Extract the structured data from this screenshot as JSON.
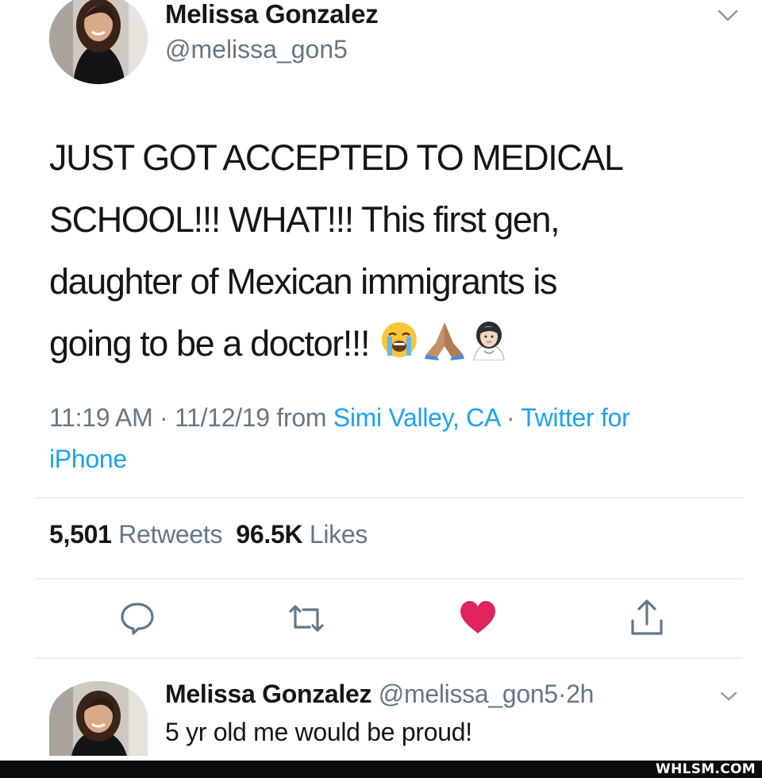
{
  "tweet": {
    "author_name": "Melissa Gonzalez",
    "author_handle": "@melissa_gon5",
    "text_lines": [
      "JUST GOT ACCEPTED TO MEDICAL",
      "SCHOOL!!! WHAT!!! This first gen,",
      "daughter of Mexican immigrants is",
      "going to be a doctor!!!"
    ],
    "emojis": [
      "loudly-crying-face",
      "folded-hands",
      "woman-health-worker"
    ],
    "time": "11:19 AM",
    "date": "11/12/19",
    "from_label": "from",
    "location": "Simi Valley, CA",
    "source_line1": "Twitter for",
    "source_line2": "iPhone",
    "separator": "·"
  },
  "stats": {
    "retweets_count": "5,501",
    "retweets_label": "Retweets",
    "likes_count": "96.5K",
    "likes_label": "Likes"
  },
  "actions": [
    {
      "name": "reply",
      "icon": "speech-bubble-icon"
    },
    {
      "name": "retweet",
      "icon": "retweet-icon"
    },
    {
      "name": "like",
      "icon": "heart-icon",
      "active": true
    },
    {
      "name": "share",
      "icon": "share-icon"
    }
  ],
  "reply": {
    "author_name": "Melissa Gonzalez",
    "author_handle": "@melissa_gon5",
    "age": "2h",
    "separator": "·",
    "text": "5 yr old me would be proud!"
  },
  "watermark": "WHLSM.COM",
  "colors": {
    "text": "#14171a",
    "muted": "#657786",
    "link": "#1da1f2",
    "like": "#e0245e",
    "divider": "#eceff1"
  }
}
